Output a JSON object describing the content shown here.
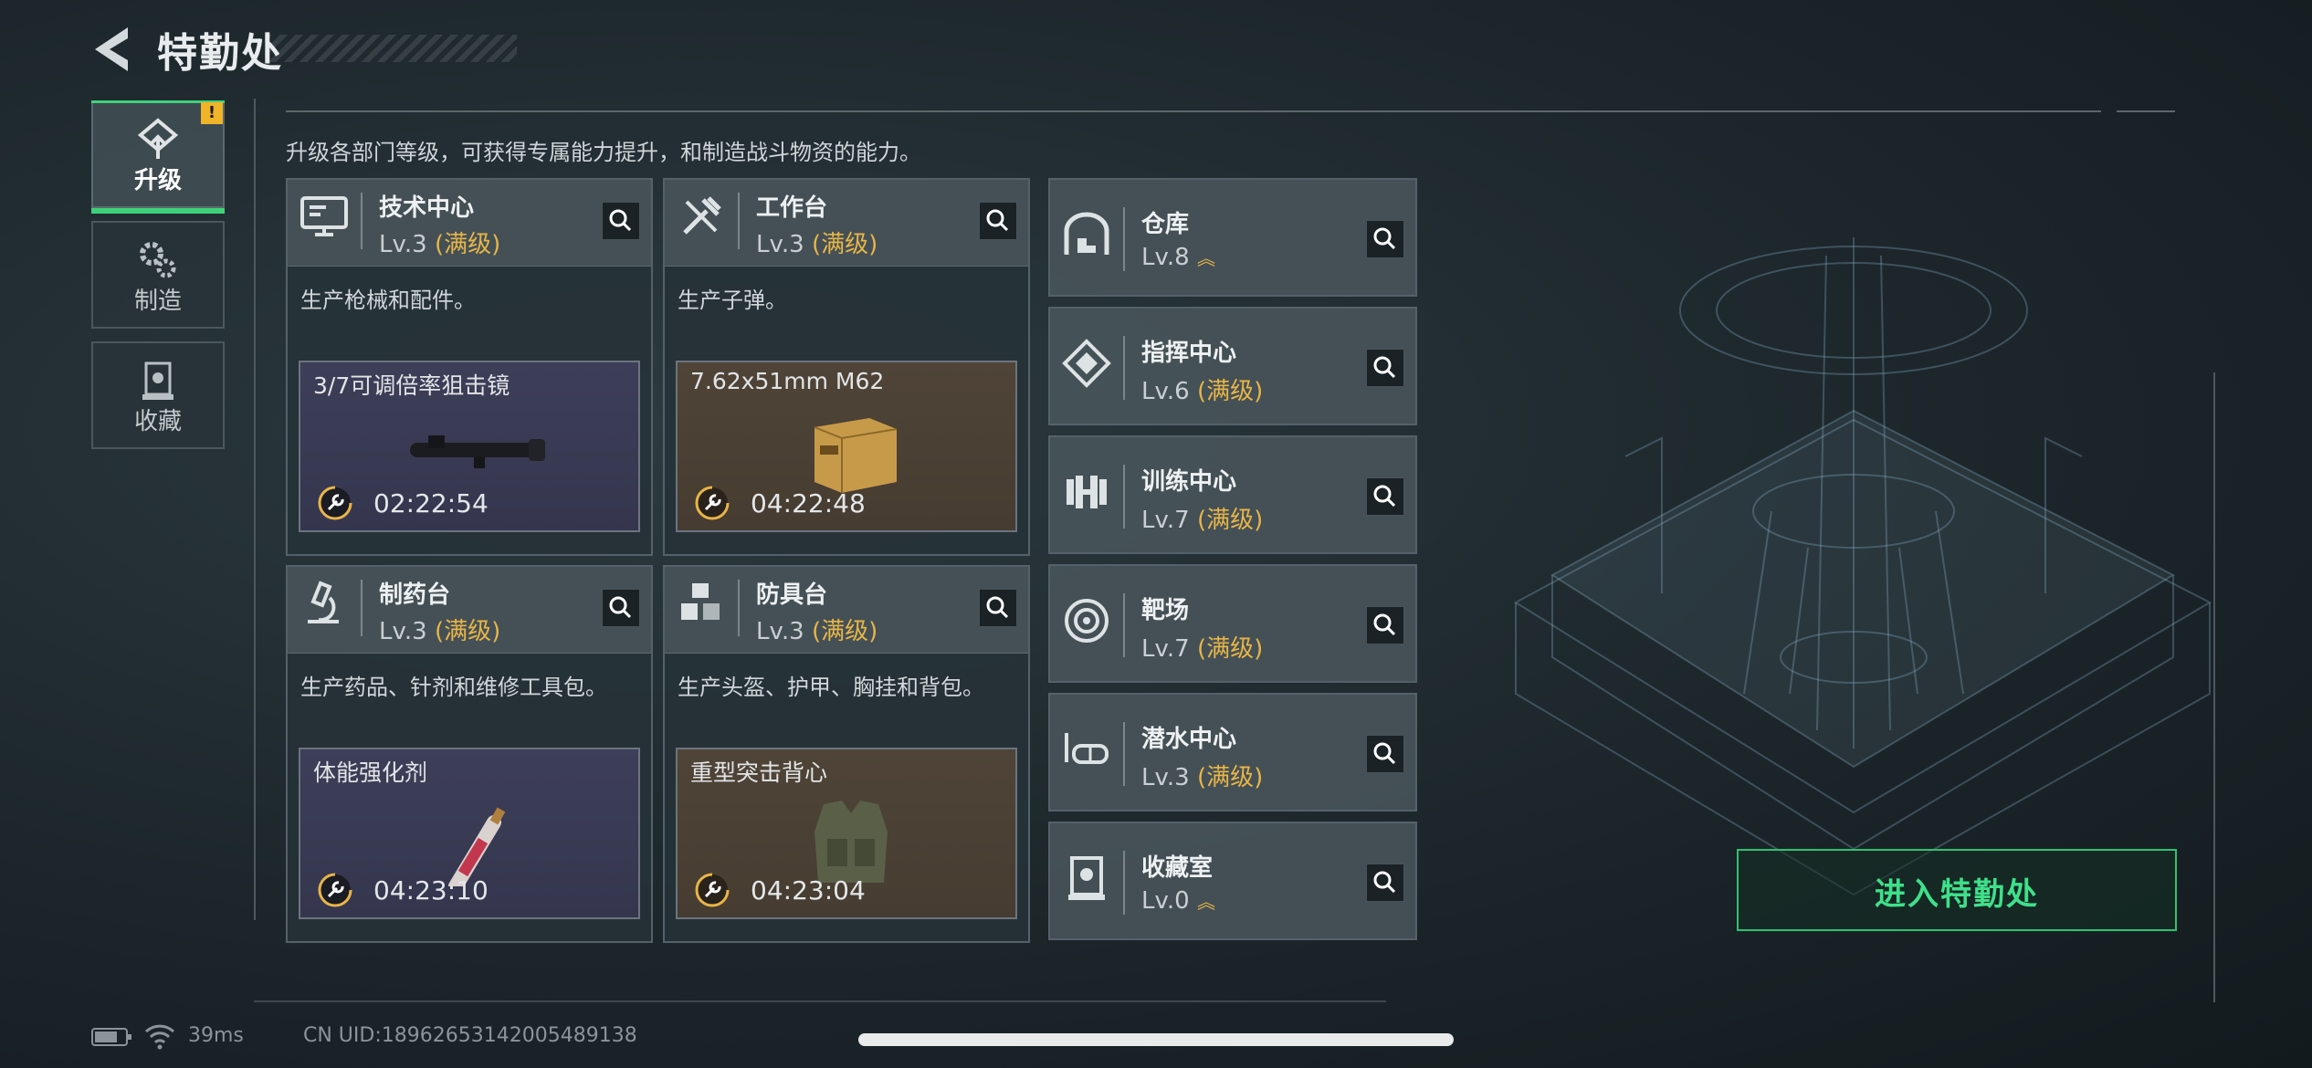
{
  "header": {
    "title": "特勤处",
    "back_icon": "back-arrow-icon"
  },
  "sidebar": {
    "items": [
      {
        "label": "升级",
        "icon": "upgrade-icon",
        "active": true,
        "alert": "!"
      },
      {
        "label": "制造",
        "icon": "gears-icon",
        "active": false
      },
      {
        "label": "收藏",
        "icon": "collection-icon",
        "active": false
      }
    ]
  },
  "description": "升级各部门等级，可获得专属能力提升，和制造战斗物资的能力。",
  "departments": [
    {
      "name": "技术中心",
      "level": "Lv.3",
      "max": "(满级)",
      "desc": "生产枪械和配件。",
      "product": "3/7可调倍率狙击镜",
      "timer": "02:22:54",
      "product_color": "purple",
      "icon": "computer-icon"
    },
    {
      "name": "工作台",
      "level": "Lv.3",
      "max": "(满级)",
      "desc": "生产子弹。",
      "product": "7.62x51mm M62",
      "timer": "04:22:48",
      "product_color": "brown",
      "icon": "tools-icon"
    },
    {
      "name": "制药台",
      "level": "Lv.3",
      "max": "(满级)",
      "desc": "生产药品、针剂和维修工具包。",
      "product": "体能强化剂",
      "timer": "04:23:10",
      "product_color": "purple",
      "icon": "microscope-icon"
    },
    {
      "name": "防具台",
      "level": "Lv.3",
      "max": "(满级)",
      "desc": "生产头盔、护甲、胸挂和背包。",
      "product": "重型突击背心",
      "timer": "04:23:04",
      "product_color": "brown",
      "icon": "cubes-icon"
    }
  ],
  "facilities": [
    {
      "name": "仓库",
      "level": "Lv.8",
      "max": "",
      "upgradable": true,
      "icon": "warehouse-icon"
    },
    {
      "name": "指挥中心",
      "level": "Lv.6",
      "max": "(满级)",
      "upgradable": false,
      "icon": "command-icon"
    },
    {
      "name": "训练中心",
      "level": "Lv.7",
      "max": "(满级)",
      "upgradable": false,
      "icon": "dumbbell-icon"
    },
    {
      "name": "靶场",
      "level": "Lv.7",
      "max": "(满级)",
      "upgradable": false,
      "icon": "target-icon"
    },
    {
      "name": "潜水中心",
      "level": "Lv.3",
      "max": "(满级)",
      "upgradable": false,
      "icon": "diving-mask-icon"
    },
    {
      "name": "收藏室",
      "level": "Lv.0",
      "max": "",
      "upgradable": true,
      "icon": "collection-room-icon"
    }
  ],
  "enter_button": "进入特勤处",
  "status": {
    "ping": "39ms",
    "uid": "CN UID:18962653142005489138"
  },
  "colors": {
    "accent": "#3fd17a",
    "max_level": "#e8b547",
    "enter": "#3fe08a"
  }
}
